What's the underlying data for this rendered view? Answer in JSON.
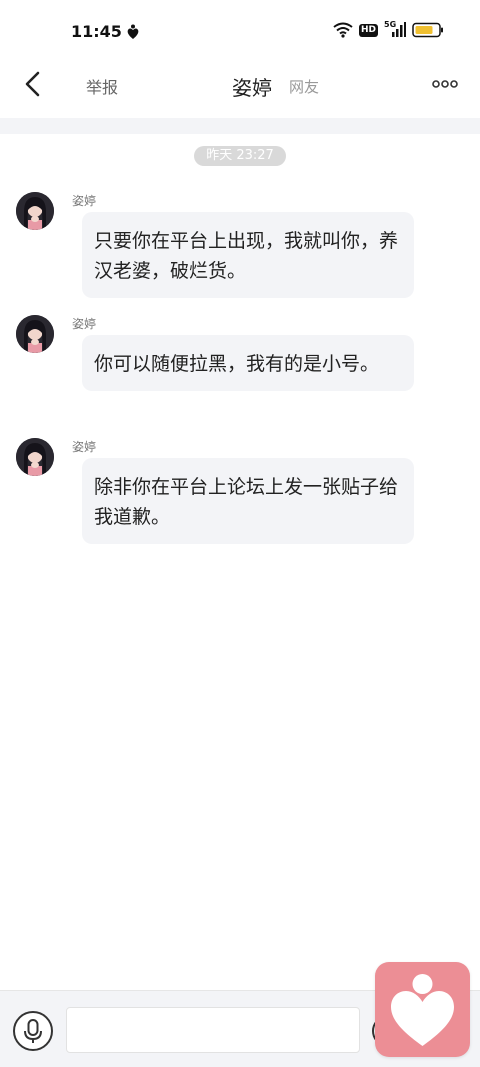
{
  "status_bar": {
    "time": "11:45",
    "network": "5G",
    "hd_badge": "HD",
    "battery_color": "#f0c030"
  },
  "nav": {
    "back_icon": "chevron-left-icon",
    "report_label": "举报",
    "title": "姿婷",
    "subtitle": "网友",
    "more_icon": "more-dots-icon"
  },
  "chat": {
    "timestamp": "昨天 23:27",
    "messages": [
      {
        "sender": "姿婷",
        "text": "只要你在平台上出现，我就叫你，养汉老婆，破烂货。"
      },
      {
        "sender": "姿婷",
        "text": "你可以随便拉黑，我有的是小号。"
      },
      {
        "sender": "姿婷",
        "text": "除非你在平台上论坛上发一张贴子给我道歉。"
      }
    ]
  },
  "input_bar": {
    "voice_icon": "microphone-icon",
    "input_value": "",
    "input_placeholder": "",
    "emoji_icon": "emoji-icon"
  },
  "floating_app": {
    "icon": "heart-person-icon",
    "color": "#ec8e95"
  }
}
